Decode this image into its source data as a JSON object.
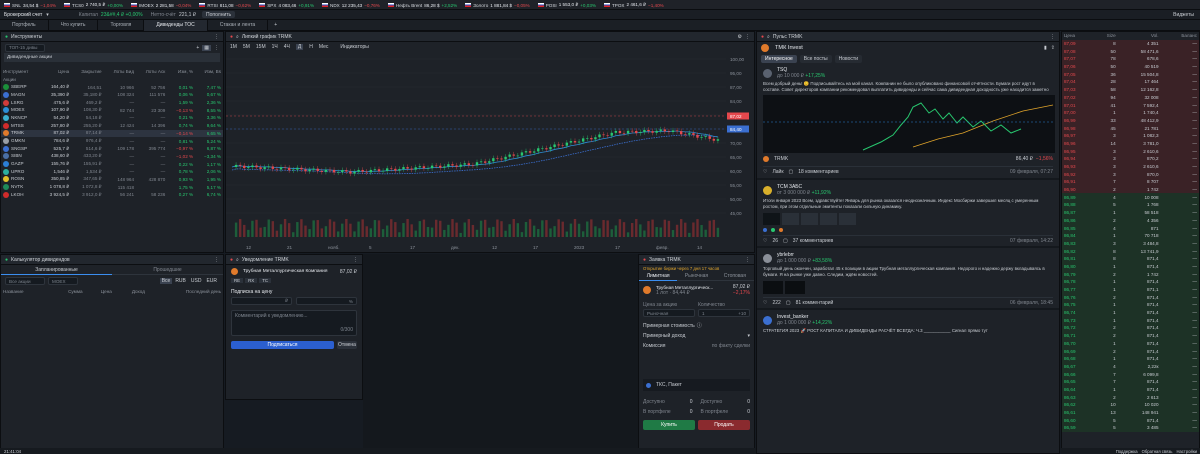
{
  "ticker": [
    {
      "name": "SNL",
      "price": "34,54 $",
      "chg": "−1,04%",
      "dir": "dn"
    },
    {
      "name": "TCS0",
      "price": "2 740,5 ₽",
      "chg": "+0,00%",
      "dir": "up"
    },
    {
      "name": "IMOEX",
      "price": "2 281,58",
      "chg": "−0,04%",
      "dir": "dn"
    },
    {
      "name": "RTSI",
      "price": "811,08",
      "chg": "−0,62%",
      "dir": "dn"
    },
    {
      "name": "SPX",
      "price": "4 083,46",
      "chg": "+0,91%",
      "dir": "up"
    },
    {
      "name": "NDX",
      "price": "12 235,43",
      "chg": "−0,76%",
      "dir": "dn"
    },
    {
      "name": "Нефть Brent",
      "price": "86,28 $",
      "chg": "+2,52%",
      "dir": "up"
    },
    {
      "name": "Золото",
      "price": "1 881,84 $",
      "chg": "−0,05%",
      "dir": "dn"
    },
    {
      "name": "POSI",
      "price": "1 553,0 ₽",
      "chg": "+0,03%",
      "dir": "up"
    },
    {
      "name": "TPOX",
      "price": "2 461,6 ₽",
      "chg": "−1,40%",
      "dir": "dn"
    }
  ],
  "bar2": {
    "account": "Брокерский счет",
    "cap_label": "Капитал",
    "cap_value": "23&##,4 ₽ +0,00%",
    "free_label": "Нетто-счёт",
    "free_value": "221,1 ₽",
    "btn": "Пополнить",
    "right": "Виджеты"
  },
  "tabs": [
    "Портфель",
    "Что купить",
    "Торговля",
    "Дивиденды ТОС",
    "Стакан и лента"
  ],
  "tabs_active": 3,
  "instruments": {
    "title": "Инструменты",
    "list_sel": "ТОП-15 дивы",
    "group": "Дивидендные акции",
    "cols": [
      "Инструмент",
      "Цена",
      "Закрытие",
      "Лоты Бид",
      "Лоты Аск",
      "Изм, %",
      "Изм, Bs"
    ],
    "section": "Акции",
    "rows": [
      {
        "t": "SBERP",
        "p": "164,40 ₽",
        "c": "164,51",
        "b": "10 966",
        "a": "52 756",
        "ch": "0,01 %",
        "cb": "7,47 %",
        "col": "#1b8e3a",
        "d": "up"
      },
      {
        "t": "MAGN",
        "p": "35,390 ₽",
        "c": "35,180 ₽",
        "b": "108 324",
        "a": "111 576",
        "ch": "0,06 %",
        "cb": "0,67 %",
        "col": "#3b6fd1",
        "d": "up"
      },
      {
        "t": "LSRG",
        "p": "475,6 ₽",
        "c": "469,2 ₽",
        "b": "—",
        "a": "—",
        "ch": "1,59 %",
        "cb": "2,36 %",
        "col": "#d13b3b",
        "d": "up"
      },
      {
        "t": "MOEX",
        "p": "107,90 ₽",
        "c": "108,30 ₽",
        "b": "82 744",
        "a": "23 309",
        "ch": "−0,13 %",
        "cb": "8,55 %",
        "col": "#2c8ed6",
        "d": "dn"
      },
      {
        "t": "NKNCP",
        "p": "54,20 ₽",
        "c": "54,18 ₽",
        "b": "—",
        "a": "—",
        "ch": "0,21 %",
        "cb": "3,36 %",
        "col": "#3bb0d1",
        "d": "up"
      },
      {
        "t": "MTSS",
        "p": "257,80 ₽",
        "c": "255,20 ₽",
        "b": "12 424",
        "a": "14 396",
        "ch": "0,74 %",
        "cb": "9,64 %",
        "col": "#d12b2b",
        "d": "up"
      },
      {
        "t": "TRMK",
        "p": "87,02 ₽",
        "c": "87,14 ₽",
        "b": "—",
        "a": "—",
        "ch": "−0,14 %",
        "cb": "6,65 %",
        "col": "#e07a2b",
        "d": "dn"
      },
      {
        "t": "GMKN",
        "p": "784,6 ₽",
        "c": "976,4 ₽",
        "b": "—",
        "a": "—",
        "ch": "0,81 %",
        "cb": "5,24 %",
        "col": "#9a9ea5",
        "d": "up"
      },
      {
        "t": "SNGSP",
        "p": "525,7 ₽",
        "c": "514,6 ₽",
        "b": "109 178",
        "a": "395 774",
        "ch": "−0,97 %",
        "cb": "6,87 %",
        "col": "#3b6fd1",
        "d": "dn"
      },
      {
        "t": "SIBN",
        "p": "438,60 ₽",
        "c": "433,20 ₽",
        "b": "—",
        "a": "—",
        "ch": "−1,02 %",
        "cb": "−3,34 %",
        "col": "#4a6fa5",
        "d": "dn"
      },
      {
        "t": "GAZP",
        "p": "155,76 ₽",
        "c": "155,91 ₽",
        "b": "—",
        "a": "—",
        "ch": "0,22 %",
        "cb": "1,17 %",
        "col": "#2c7fd6",
        "d": "up"
      },
      {
        "t": "UPRO",
        "p": "1,546 ₽",
        "c": "1,534 ₽",
        "b": "—",
        "a": "—",
        "ch": "0,78 %",
        "cb": "2,06 %",
        "col": "#2cb0a0",
        "d": "up"
      },
      {
        "t": "ROSN",
        "p": "350,85 ₽",
        "c": "347,65 ₽",
        "b": "148 964",
        "a": "428 870",
        "ch": "0,93 %",
        "cb": "1,95 %",
        "col": "#e0c02b",
        "d": "up"
      },
      {
        "t": "NVTK",
        "p": "1 078,8 ₽",
        "c": "1 072,8 ₽",
        "b": "115 418",
        "a": "",
        "ch": "1,75 %",
        "cb": "5,17 %",
        "col": "#1f8a5a",
        "d": "up"
      },
      {
        "t": "LKOH",
        "p": "3 924,5 ₽",
        "c": "3 912,0 ₽",
        "b": "56 241",
        "a": "58 236",
        "ch": "0,27 %",
        "cb": "6,74 %",
        "col": "#d12b2b",
        "d": "up"
      }
    ],
    "selected_row": 6
  },
  "chart": {
    "title": "Липкий график TRMK",
    "intervals": [
      "1M",
      "5M",
      "15M",
      "1Ч",
      "4Ч",
      "Д",
      "Н",
      "Мес"
    ],
    "indicators": "Индикаторы",
    "price_ticks": [
      "100,00",
      "95,00",
      "87,00",
      "84,00",
      "80,00",
      "75,00",
      "70,00",
      "65,00",
      "60,00",
      "55,00",
      "50,00",
      "45,00"
    ],
    "price_tags": [
      {
        "v": "87,02",
        "c": "#e5484d"
      },
      {
        "v": "84,40",
        "c": "#3b6fd1"
      }
    ],
    "x_ticks": [
      "12",
      "21",
      "нояб.",
      "5",
      "17",
      "дек.",
      "12",
      "17",
      "2023",
      "17",
      "февр.",
      "14"
    ]
  },
  "pulse": {
    "title": "Пульс TRMK",
    "subject": "ТМК Invest",
    "tabs": [
      "Интересное",
      "Все посты",
      "Новости"
    ],
    "post1": {
      "author": "TSQ",
      "meta": "до 10 000 ₽",
      "pct": "+17,25%",
      "text": "Всем добрый день! 😊 Подписывайтесь на мой канал. Компании не было опубликовано финансовой отчётности. Бумаги рост идут в составе. Совет директоров компании рекомендовал выплатить дивиденды и сейчас сама дивидендная доходность уже находится заметно выше средних значений по рынку.",
      "tag": "TRMK",
      "tag_price": "86,40 ₽",
      "tag_chg": "−1,56%",
      "likes": "Лайк",
      "comments": "18 комментариев",
      "time": "09 февраля, 07:27"
    },
    "post2": {
      "author": "ТСМ 3АБС",
      "meta": "от 3 000 000 ₽",
      "pct": "+11,92%",
      "text": "Итоги января 2023 Всем, здравствуйте! Январь для рынка оказался неоднозначным. Индекс Мосбиржи завершил месяц с умеренным ростом, при этом отдельные эмитенты показали сильную динамику.",
      "likes": "26",
      "comments": "37 комментариев",
      "time": "07 февраля, 14:22"
    },
    "post3": {
      "author": "ybrlebrr",
      "meta": "до 1 000 000 ₽",
      "pct": "+83,58%",
      "text": "Торговый день окончен, заработал 45 к позиции в акции Трубная металлургическая компания. Недорого и надежно держу вкладываясь в бумаги. Я на рынке уже давно. Следим, ждём новостей.",
      "likes": "222",
      "comments": "81 комментарий",
      "time": "06 февраля, 18:45"
    },
    "post4": {
      "author": "Invest_banker",
      "meta": "до 1 000 000 ₽",
      "pct": "+14,22%",
      "text": "СТРАТЕГИЯ 2023 🚀 РОСТ КАПИТАЛА И ДИВИДЕНДЫ РАСЧЁТ ВСЕГДА: Ч.3 ___________ Сигнал прямо тут"
    }
  },
  "book": {
    "cols": [
      "Цена",
      "Size",
      "Vol.",
      "Баланс"
    ],
    "rows": [
      [
        "87,09",
        "8",
        "4 351",
        "—"
      ],
      [
        "87,08",
        "50",
        "58 471,6",
        "—"
      ],
      [
        "87,07",
        "78",
        "678,6",
        "—"
      ],
      [
        "87,06",
        "50",
        "40 519",
        "—"
      ],
      [
        "87,05",
        "36",
        "15 504,8",
        "—"
      ],
      [
        "87,04",
        "28",
        "17 464",
        "—"
      ],
      [
        "87,03",
        "58",
        "12 162,8",
        "—"
      ],
      [
        "87,02",
        "94",
        "32 008",
        "—"
      ],
      [
        "87,01",
        "41",
        "7 592,4",
        "—"
      ],
      [
        "87,00",
        "1",
        "1 740,4",
        "—"
      ],
      [
        "86,99",
        "33",
        "48 412,9",
        "—"
      ],
      [
        "86,98",
        "45",
        "21 781",
        "—"
      ],
      [
        "86,97",
        "3",
        "1 082,3",
        "—"
      ],
      [
        "86,96",
        "14",
        "3 781,0",
        "—"
      ],
      [
        "86,95",
        "3",
        "2 610,6",
        "—"
      ],
      [
        "86,94",
        "3",
        "870,2",
        "—"
      ],
      [
        "86,93",
        "3",
        "2 610,6",
        "—"
      ],
      [
        "86,92",
        "3",
        "870,0",
        "—"
      ],
      [
        "86,91",
        "7",
        "8 707",
        "—"
      ],
      [
        "86,90",
        "2",
        "1 742",
        "—"
      ],
      [
        "86,89",
        "4",
        "10 008",
        "—"
      ],
      [
        "86,88",
        "5",
        "1 768",
        "—"
      ],
      [
        "86,87",
        "1",
        "58 518",
        "—"
      ],
      [
        "86,86",
        "2",
        "4 356",
        "—"
      ],
      [
        "86,85",
        "4",
        "871",
        "—"
      ],
      [
        "86,84",
        "1",
        "70 718",
        "—"
      ],
      [
        "86,83",
        "3",
        "3 484,8",
        "—"
      ],
      [
        "86,82",
        "8",
        "13 741,9",
        "—"
      ],
      [
        "86,81",
        "8",
        "871,4",
        "—"
      ],
      [
        "86,80",
        "1",
        "871,4",
        "—"
      ],
      [
        "86,79",
        "2",
        "1 742",
        "—"
      ],
      [
        "86,78",
        "1",
        "871,4",
        "—"
      ],
      [
        "86,77",
        "1",
        "871,1",
        "—"
      ],
      [
        "86,76",
        "2",
        "871,4",
        "—"
      ],
      [
        "86,75",
        "1",
        "871,4",
        "—"
      ],
      [
        "86,74",
        "1",
        "871,4",
        "—"
      ],
      [
        "86,73",
        "1",
        "871,4",
        "—"
      ],
      [
        "86,72",
        "2",
        "871,4",
        "—"
      ],
      [
        "86,71",
        "2",
        "871,4",
        "—"
      ],
      [
        "86,70",
        "1",
        "871,4",
        "—"
      ],
      [
        "86,69",
        "2",
        "871,4",
        "—"
      ],
      [
        "86,68",
        "1",
        "871,4",
        "—"
      ],
      [
        "86,67",
        "4",
        "2,22к",
        "—"
      ],
      [
        "86,66",
        "7",
        "6 099,8",
        "—"
      ],
      [
        "86,65",
        "7",
        "871,4",
        "—"
      ],
      [
        "86,64",
        "1",
        "871,4",
        "—"
      ],
      [
        "86,63",
        "2",
        "2 613",
        "—"
      ],
      [
        "86,62",
        "10",
        "10 020",
        "—"
      ],
      [
        "86,61",
        "13",
        "148 941",
        "—"
      ],
      [
        "86,60",
        "5",
        "871,4",
        "—"
      ],
      [
        "86,59",
        "5",
        "3 485",
        "—"
      ]
    ],
    "split": 20
  },
  "divcalc": {
    "title": "Калькулятор дивидендов",
    "tabs": [
      "Запланированные",
      "Прошедшие"
    ],
    "sel1": "Все акции",
    "sel2": "MOEX",
    "curr": [
      "Все",
      "RUB",
      "USD",
      "EUR"
    ],
    "cols": [
      "Название",
      "Сумма",
      "Цена",
      "Доход",
      "Последний день"
    ]
  },
  "order": {
    "title": "Уведомление TRMK",
    "company": "Трубная Металлургическая Компания",
    "price": "87,02 ₽",
    "chips": [
      "RE",
      "RX",
      "ТС"
    ],
    "section": "Подписка на цену",
    "price_ph": "₽",
    "pct_ph": "%",
    "comment_ph": "Комментарий к уведомлению...",
    "count": "0/300",
    "submit": "Подписаться",
    "cancel": "Отмена"
  },
  "trade": {
    "title": "Заявка TRMK",
    "status": "Открытие биржи через 7 дня 17 часов",
    "tabs": [
      "Лимитная",
      "Рыночная",
      "Стоповая"
    ],
    "company": "Трубная Металлургическ...",
    "sub": "1 лот · 84,44 ₽",
    "price": "87,02 ₽",
    "chg": "−2,17%",
    "price_label": "Цена за акцию",
    "qty_label": "Количество",
    "price_ph": "Рыночная",
    "qty": "1",
    "max": "+10",
    "approx": "Примерная стоимость",
    "est": "Примерный доход",
    "comm": "Комиссия",
    "comm_v": "по факту сделки",
    "broker": "ТКС, Пакет",
    "avail": "Доступно",
    "avail_v": "0",
    "inpf": "В портфеле",
    "inpf_v": "0",
    "buy": "Купить",
    "sell": "Продать"
  },
  "status": {
    "time": "21:41:04",
    "right": [
      "Поддержка",
      "Обратная связь",
      "Настройки"
    ]
  }
}
